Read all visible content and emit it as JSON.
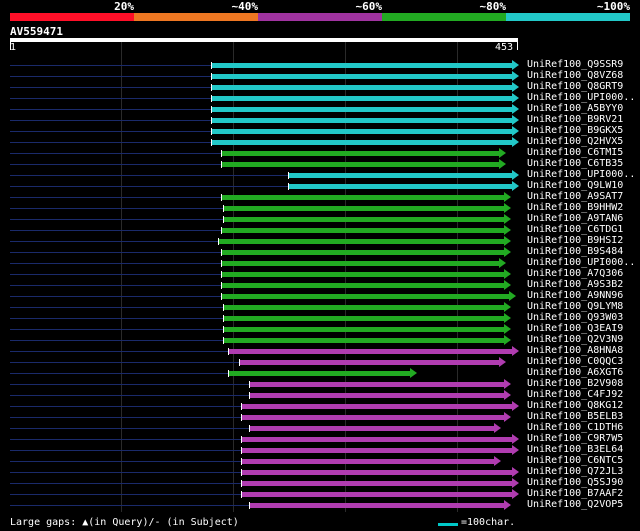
{
  "legend": {
    "segments": [
      {
        "color": "#ff0f28"
      },
      {
        "color": "#ee7722"
      },
      {
        "color": "#a033a0"
      },
      {
        "color": "#22aa22"
      },
      {
        "color": "#22c8c8"
      }
    ],
    "labels": [
      "20%",
      "~40%",
      "~60%",
      "~80%",
      "~100%"
    ]
  },
  "query": {
    "id": "AV559471",
    "start": "1",
    "end": "453"
  },
  "colors": {
    "cyan": "#22c8c8",
    "green": "#22aa22",
    "purple": "#b03cb0",
    "dim": "#1a2a6a"
  },
  "hits": [
    {
      "label": "UniRef100_Q9SSR9",
      "color": "cyan",
      "start": 0.395,
      "end": 1.0
    },
    {
      "label": "UniRef100_Q8VZ68",
      "color": "cyan",
      "start": 0.395,
      "end": 1.0
    },
    {
      "label": "UniRef100_Q8GRT9",
      "color": "cyan",
      "start": 0.395,
      "end": 1.0
    },
    {
      "label": "UniRef100_UPI000..",
      "color": "cyan",
      "start": 0.395,
      "end": 1.0
    },
    {
      "label": "UniRef100_A5BYY0",
      "color": "cyan",
      "start": 0.395,
      "end": 1.0
    },
    {
      "label": "UniRef100_B9RV21",
      "color": "cyan",
      "start": 0.395,
      "end": 1.0
    },
    {
      "label": "UniRef100_B9GKX5",
      "color": "cyan",
      "start": 0.395,
      "end": 1.0
    },
    {
      "label": "UniRef100_Q2HVX5",
      "color": "cyan",
      "start": 0.395,
      "end": 1.0
    },
    {
      "label": "UniRef100_C6TMI5",
      "color": "green",
      "start": 0.415,
      "end": 0.975
    },
    {
      "label": "UniRef100_C6TB35",
      "color": "green",
      "start": 0.415,
      "end": 0.975
    },
    {
      "label": "UniRef100_UPI000..",
      "color": "cyan",
      "start": 0.548,
      "end": 1.0
    },
    {
      "label": "UniRef100_Q9LW10",
      "color": "cyan",
      "start": 0.548,
      "end": 1.0
    },
    {
      "label": "UniRef100_A9SAT7",
      "color": "green",
      "start": 0.415,
      "end": 0.985
    },
    {
      "label": "UniRef100_B9HHW2",
      "color": "green",
      "start": 0.42,
      "end": 0.985
    },
    {
      "label": "UniRef100_A9TAN6",
      "color": "green",
      "start": 0.42,
      "end": 0.985
    },
    {
      "label": "UniRef100_C6TDG1",
      "color": "green",
      "start": 0.415,
      "end": 0.985
    },
    {
      "label": "UniRef100_B9HSI2",
      "color": "green",
      "start": 0.41,
      "end": 0.985
    },
    {
      "label": "UniRef100_B9S484",
      "color": "green",
      "start": 0.415,
      "end": 0.985
    },
    {
      "label": "UniRef100_UPI000..",
      "color": "green",
      "start": 0.415,
      "end": 0.975
    },
    {
      "label": "UniRef100_A7Q306",
      "color": "green",
      "start": 0.415,
      "end": 0.985
    },
    {
      "label": "UniRef100_A9S3B2",
      "color": "green",
      "start": 0.415,
      "end": 0.985
    },
    {
      "label": "UniRef100_A9NN96",
      "color": "green",
      "start": 0.415,
      "end": 0.995
    },
    {
      "label": "UniRef100_Q9LYM8",
      "color": "green",
      "start": 0.42,
      "end": 0.985
    },
    {
      "label": "UniRef100_Q93W03",
      "color": "green",
      "start": 0.42,
      "end": 0.985
    },
    {
      "label": "UniRef100_Q3EAI9",
      "color": "green",
      "start": 0.42,
      "end": 0.985
    },
    {
      "label": "UniRef100_Q2V3N9",
      "color": "green",
      "start": 0.42,
      "end": 0.985
    },
    {
      "label": "UniRef100_A8HNA8",
      "color": "purple",
      "start": 0.43,
      "end": 1.0
    },
    {
      "label": "UniRef100_C0QQC3",
      "color": "purple",
      "start": 0.45,
      "end": 0.975
    },
    {
      "label": "UniRef100_A6XGT6",
      "color": "green",
      "start": 0.43,
      "end": 0.8
    },
    {
      "label": "UniRef100_B2V908",
      "color": "purple",
      "start": 0.47,
      "end": 0.985
    },
    {
      "label": "UniRef100_C4FJ92",
      "color": "purple",
      "start": 0.47,
      "end": 0.985
    },
    {
      "label": "UniRef100_Q8KG12",
      "color": "purple",
      "start": 0.455,
      "end": 1.0
    },
    {
      "label": "UniRef100_B5ELB3",
      "color": "purple",
      "start": 0.455,
      "end": 0.985
    },
    {
      "label": "UniRef100_C1DTH6",
      "color": "purple",
      "start": 0.47,
      "end": 0.965
    },
    {
      "label": "UniRef100_C9R7W5",
      "color": "purple",
      "start": 0.455,
      "end": 1.0
    },
    {
      "label": "UniRef100_B3EL64",
      "color": "purple",
      "start": 0.455,
      "end": 1.0
    },
    {
      "label": "UniRef100_C6NTC5",
      "color": "purple",
      "start": 0.455,
      "end": 0.965
    },
    {
      "label": "UniRef100_Q72JL3",
      "color": "purple",
      "start": 0.455,
      "end": 1.0
    },
    {
      "label": "UniRef100_Q5SJ90",
      "color": "purple",
      "start": 0.455,
      "end": 1.0
    },
    {
      "label": "UniRef100_B7AAF2",
      "color": "purple",
      "start": 0.455,
      "end": 1.0
    },
    {
      "label": "UniRef100_Q2VOP5",
      "color": "purple",
      "start": 0.47,
      "end": 0.985
    }
  ],
  "footer": {
    "gaps_label": "Large gaps: ▲(in Query)/- (in Subject)",
    "scale_label": "=100char."
  }
}
